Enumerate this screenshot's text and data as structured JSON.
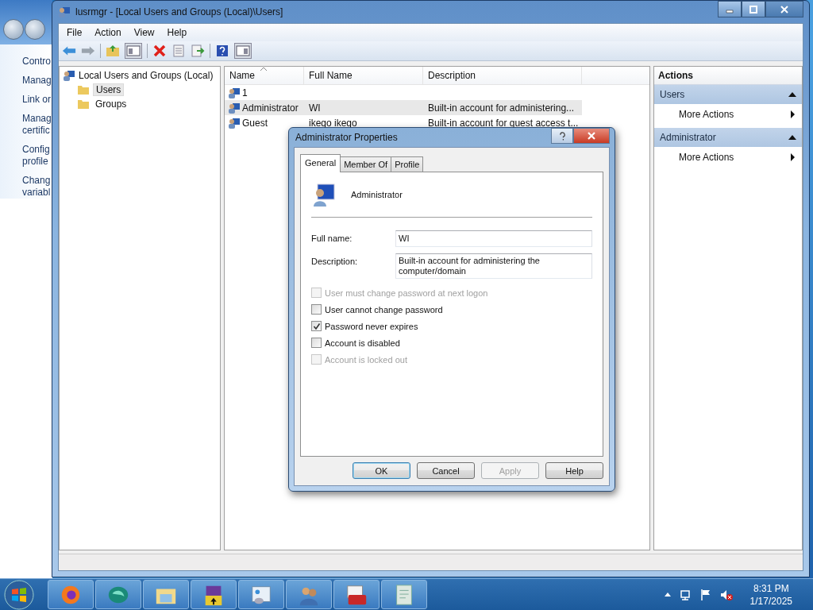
{
  "background_window": {
    "items": [
      {
        "lines": [
          "Contro"
        ]
      },
      {
        "lines": [
          "Manag"
        ]
      },
      {
        "lines": [
          "Link or"
        ]
      },
      {
        "lines": [
          "Manag",
          "certific"
        ]
      },
      {
        "lines": [
          "Config",
          "profile"
        ]
      },
      {
        "lines": [
          "Chang",
          "variabl"
        ]
      }
    ]
  },
  "window": {
    "title": "lusrmgr - [Local Users and Groups (Local)\\Users]"
  },
  "menu": [
    "File",
    "Action",
    "View",
    "Help"
  ],
  "tree": {
    "root": "Local Users and Groups (Local)",
    "children": [
      {
        "label": "Users",
        "selected": true
      },
      {
        "label": "Groups",
        "selected": false
      }
    ]
  },
  "table": {
    "columns": [
      "Name",
      "Full Name",
      "Description"
    ],
    "rows": [
      {
        "name": "1",
        "selected": false
      },
      {
        "name": "Administrator",
        "full_name": "WI",
        "description": "Built-in account for administering...",
        "selected": true
      },
      {
        "name": "Guest",
        "full_name": "ikego ikego",
        "description": "Built-in account for guest access t...",
        "selected": false
      }
    ]
  },
  "actions": {
    "title": "Actions",
    "sections": [
      {
        "title": "Users",
        "items": [
          "More Actions"
        ]
      },
      {
        "title": "Administrator",
        "items": [
          "More Actions"
        ]
      }
    ]
  },
  "dialog": {
    "title": "Administrator Properties",
    "tabs": [
      {
        "label": "General",
        "selected": true
      },
      {
        "label": "Member Of",
        "selected": false
      },
      {
        "label": "Profile",
        "selected": false
      }
    ],
    "user_name": "Administrator",
    "fields": [
      {
        "label": "Full name:",
        "value": "WI",
        "kind": "line"
      },
      {
        "label": "Description:",
        "value": "Built-in account for administering the computer/domain",
        "kind": "area"
      }
    ],
    "checkboxes": [
      {
        "label": "User must change password at next logon",
        "checked": false,
        "disabled": true
      },
      {
        "label": "User cannot change password",
        "checked": false,
        "disabled": false
      },
      {
        "label": "Password never expires",
        "checked": true,
        "disabled": false
      },
      {
        "label": "Account is disabled",
        "checked": false,
        "disabled": false
      },
      {
        "label": "Account is locked out",
        "checked": false,
        "disabled": true
      }
    ],
    "buttons": [
      {
        "label": "OK",
        "disabled": false,
        "default": true
      },
      {
        "label": "Cancel",
        "disabled": false,
        "default": false
      },
      {
        "label": "Apply",
        "disabled": true,
        "default": false
      },
      {
        "label": "Help",
        "disabled": false,
        "default": false
      }
    ]
  },
  "taskbar": {
    "time": "8:31 PM",
    "date": "1/17/2025"
  }
}
